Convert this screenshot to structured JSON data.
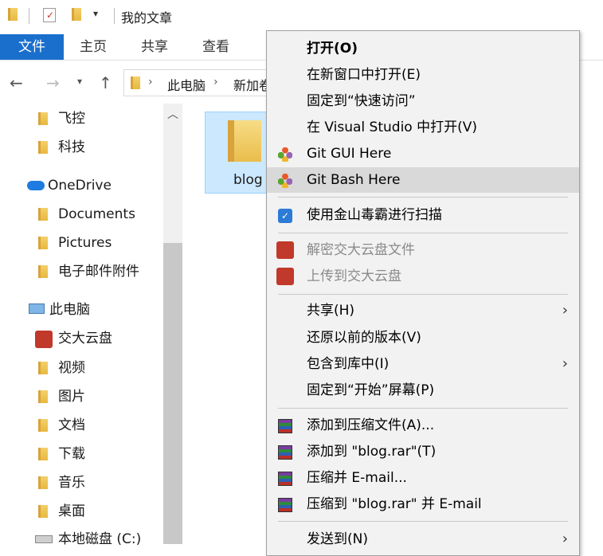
{
  "window": {
    "title": "我的文章"
  },
  "ribbon": {
    "tabs": [
      "文件",
      "主页",
      "共享",
      "查看"
    ]
  },
  "address": {
    "segments": [
      "此电脑",
      "新加卷"
    ]
  },
  "nav": {
    "items": [
      {
        "label": "飞控",
        "icon": "folder-icon"
      },
      {
        "label": "科技",
        "icon": "folder-icon"
      },
      {
        "label": "OneDrive",
        "icon": "cloud-icon"
      },
      {
        "label": "Documents",
        "icon": "folder-icon"
      },
      {
        "label": "Pictures",
        "icon": "folder-icon"
      },
      {
        "label": "电子邮件附件",
        "icon": "folder-icon"
      },
      {
        "label": "此电脑",
        "icon": "computer-icon"
      },
      {
        "label": "交大云盘",
        "icon": "jiaoda-cloud-icon"
      },
      {
        "label": "视频",
        "icon": "video-folder-icon"
      },
      {
        "label": "图片",
        "icon": "pictures-folder-icon"
      },
      {
        "label": "文档",
        "icon": "documents-folder-icon"
      },
      {
        "label": "下载",
        "icon": "downloads-folder-icon"
      },
      {
        "label": "音乐",
        "icon": "music-folder-icon"
      },
      {
        "label": "桌面",
        "icon": "desktop-folder-icon"
      },
      {
        "label": "本地磁盘 (C:)",
        "icon": "drive-icon"
      }
    ]
  },
  "content": {
    "selected_folder": "blog"
  },
  "menu": {
    "items": [
      {
        "label": "打开(O)",
        "bold": true
      },
      {
        "label": "在新窗口中打开(E)"
      },
      {
        "label": "固定到“快速访问”"
      },
      {
        "label": "在 Visual Studio 中打开(V)"
      },
      {
        "label": "Git GUI Here",
        "icon": "git-icon"
      },
      {
        "label": "Git Bash Here",
        "icon": "git-icon",
        "hover": true
      },
      {
        "label": "使用金山毒霸进行扫描",
        "icon": "duba-icon"
      },
      {
        "label": "解密交大云盘文件",
        "icon": "jiaoda-icon",
        "disabled": true
      },
      {
        "label": "上传到交大云盘",
        "icon": "jiaoda-icon",
        "disabled": true
      },
      {
        "label": "共享(H)",
        "submenu": true
      },
      {
        "label": "还原以前的版本(V)"
      },
      {
        "label": "包含到库中(I)",
        "submenu": true
      },
      {
        "label": "固定到“开始”屏幕(P)"
      },
      {
        "label": "添加到压缩文件(A)...",
        "icon": "winrar-icon"
      },
      {
        "label": "添加到 \"blog.rar\"(T)",
        "icon": "winrar-icon"
      },
      {
        "label": "压缩并 E-mail...",
        "icon": "winrar-icon"
      },
      {
        "label": "压缩到 \"blog.rar\" 并 E-mail",
        "icon": "winrar-icon"
      },
      {
        "label": "发送到(N)",
        "submenu": true
      }
    ]
  }
}
